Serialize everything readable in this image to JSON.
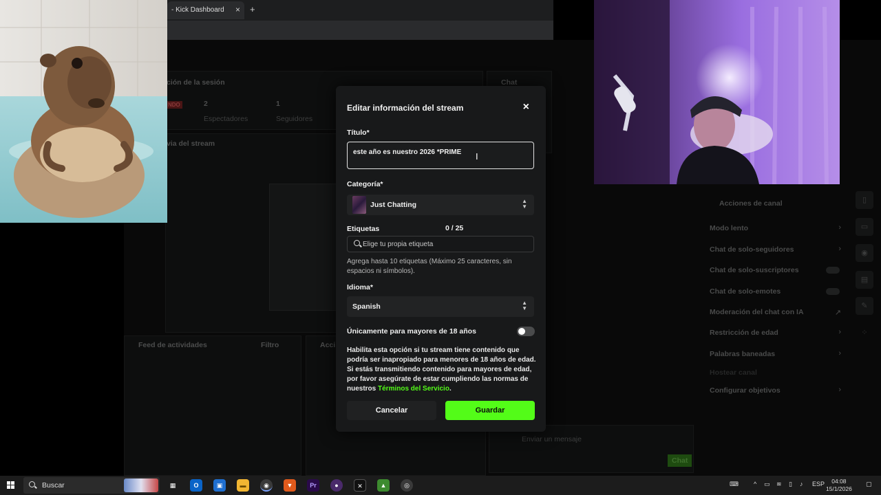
{
  "browser": {
    "tab_title": "- Kick Dashboard",
    "tab_close": "×",
    "new_tab": "+"
  },
  "dashboard": {
    "session_title": "ción de la sesión",
    "live_badge": "NDO",
    "viewers_count": "2",
    "viewers_label": "Espectadores",
    "followers_count": "1",
    "followers_label": "Seguidores",
    "chat_label": "Chat",
    "preview_label": "via del stream",
    "feed_label": "Feed de actividades",
    "filter_label": "Filtro",
    "actions_partial": "Acci",
    "chat_input_placeholder": "Enviar un mensaje",
    "chat_button": "Chat",
    "channel_actions": {
      "title": "Acciones de canal",
      "items": [
        {
          "label": "Modo lento",
          "control": "arrow"
        },
        {
          "label": "Chat de solo-seguidores",
          "control": "arrow"
        },
        {
          "label": "Chat de solo-suscriptores",
          "control": "toggle"
        },
        {
          "label": "Chat de solo-emotes",
          "control": "toggle"
        },
        {
          "label": "Moderación del chat con IA",
          "control": "external"
        },
        {
          "label": "Restricción de edad",
          "control": "arrow"
        },
        {
          "label": "Palabras baneadas",
          "control": "arrow"
        },
        {
          "label": "Hostear canal",
          "control": "none"
        },
        {
          "label": "Configurar objetivos",
          "control": "arrow"
        }
      ]
    }
  },
  "modal": {
    "title": "Editar información del stream",
    "close": "×",
    "title_label": "Título*",
    "title_value": "este año es nuestro 2026 *PRIME",
    "category_label": "Categoría*",
    "category_value": "Just Chatting",
    "tags_label": "Etiquetas",
    "tags_count": "0 / 25",
    "tags_placeholder": "Elige tu propia etiqueta",
    "tags_help": "Agrega hasta 10 etiquetas (Máximo 25 caracteres, sin espacios ni símbolos).",
    "language_label": "Idioma*",
    "language_value": "Spanish",
    "adult_label": "Únicamente para mayores de 18 años",
    "adult_enabled": false,
    "adult_desc": "Habilita esta opción si tu stream tiene contenido que podría ser inapropiado para menores de 18 años de edad. Si estás transmitiendo contenido para mayores de edad, por favor asegúrate de estar cumpliendo las normas de nuestros ",
    "terms_link": "Términos del Servicio",
    "terms_suffix": ".",
    "cancel": "Cancelar",
    "save": "Guardar",
    "accent_color": "#53fc18"
  },
  "taskbar": {
    "search_label": "Buscar",
    "lang": "ESP",
    "time": "04:08",
    "date": "15/1/2026",
    "apps": [
      "task-view",
      "outlook",
      "store",
      "file-explorer",
      "chrome",
      "brave",
      "premiere",
      "obs",
      "capcut",
      "android",
      "screen-recorder"
    ]
  }
}
